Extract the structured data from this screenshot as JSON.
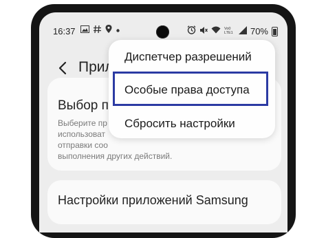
{
  "status_bar": {
    "time": "16:37",
    "icons_left": [
      "image-icon",
      "hashtag-icon",
      "location-icon",
      "dot-icon"
    ],
    "icons_right": [
      "alarm-icon",
      "mute-icon",
      "wifi-icon",
      "volte-icon",
      "signal-icon"
    ],
    "battery": "70%"
  },
  "header": {
    "title": "Прило"
  },
  "card1": {
    "title": "Выбор пр",
    "description": "Выберите пр\nиспользоват\nотправки соо\nвыполнения других действий."
  },
  "card2": {
    "title": "Настройки приложений Samsung"
  },
  "menu": {
    "items": [
      {
        "label": "Диспетчер разрешений"
      },
      {
        "label": "Особые права доступа"
      },
      {
        "label": "Сбросить настройки"
      }
    ]
  },
  "colors": {
    "highlight": "#2b3aa3",
    "background": "#ededed",
    "phone_frame": "#151515"
  }
}
